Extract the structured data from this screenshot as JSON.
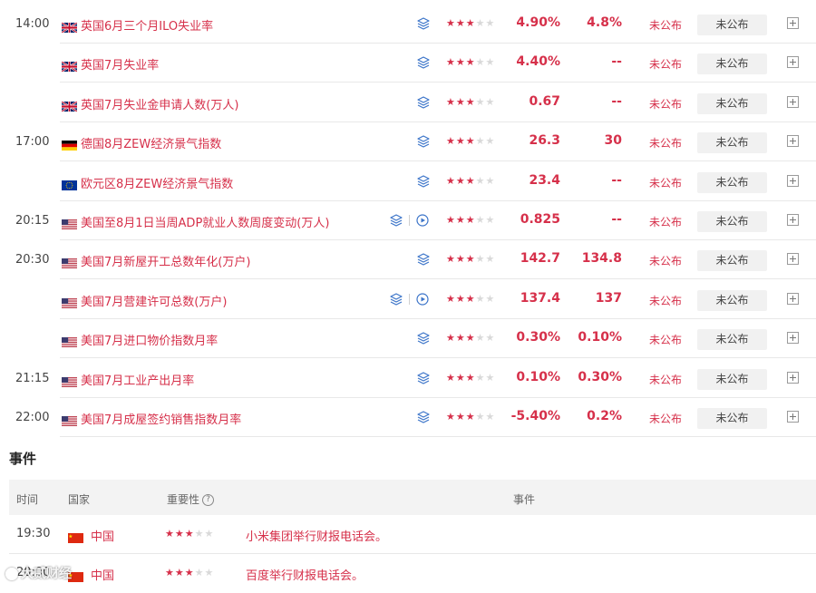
{
  "colors": {
    "accent": "#d6304a",
    "star_on": "#d6304a",
    "star_off": "#d9d9d9",
    "icon_blue": "#3b74c9"
  },
  "rows": [
    {
      "time": "14:00",
      "flag": "uk",
      "name": "英国6月三个月ILO失业率",
      "video": false,
      "stars": 3,
      "previous": "4.90%",
      "forecast": "4.8%",
      "status": "未公布",
      "button": "未公布"
    },
    {
      "time": "",
      "flag": "uk",
      "name": "英国7月失业率",
      "video": false,
      "stars": 3,
      "previous": "4.40%",
      "forecast": "--",
      "status": "未公布",
      "button": "未公布"
    },
    {
      "time": "",
      "flag": "uk",
      "name": "英国7月失业金申请人数(万人)",
      "video": false,
      "stars": 3,
      "previous": "0.67",
      "forecast": "--",
      "status": "未公布",
      "button": "未公布"
    },
    {
      "time": "17:00",
      "flag": "de",
      "name": "德国8月ZEW经济景气指数",
      "video": false,
      "stars": 3,
      "previous": "26.3",
      "forecast": "30",
      "status": "未公布",
      "button": "未公布"
    },
    {
      "time": "",
      "flag": "eu",
      "name": "欧元区8月ZEW经济景气指数",
      "video": false,
      "stars": 3,
      "previous": "23.4",
      "forecast": "--",
      "status": "未公布",
      "button": "未公布"
    },
    {
      "time": "20:15",
      "flag": "us",
      "name": "美国至8月1日当周ADP就业人数周度变动(万人)",
      "video": true,
      "stars": 3,
      "previous": "0.825",
      "forecast": "--",
      "status": "未公布",
      "button": "未公布"
    },
    {
      "time": "20:30",
      "flag": "us",
      "name": "美国7月新屋开工总数年化(万户)",
      "video": false,
      "stars": 3,
      "previous": "142.7",
      "forecast": "134.8",
      "status": "未公布",
      "button": "未公布"
    },
    {
      "time": "",
      "flag": "us",
      "name": "美国7月营建许可总数(万户)",
      "video": true,
      "stars": 3,
      "previous": "137.4",
      "forecast": "137",
      "status": "未公布",
      "button": "未公布"
    },
    {
      "time": "",
      "flag": "us",
      "name": "美国7月进口物价指数月率",
      "video": false,
      "stars": 3,
      "previous": "0.30%",
      "forecast": "0.10%",
      "status": "未公布",
      "button": "未公布"
    },
    {
      "time": "21:15",
      "flag": "us",
      "name": "美国7月工业产出月率",
      "video": false,
      "stars": 3,
      "previous": "0.10%",
      "forecast": "0.30%",
      "status": "未公布",
      "button": "未公布"
    },
    {
      "time": "22:00",
      "flag": "us",
      "name": "美国7月成屋签约销售指数月率",
      "video": false,
      "stars": 3,
      "previous": "-5.40%",
      "forecast": "0.2%",
      "status": "未公布",
      "button": "未公布"
    }
  ],
  "events": {
    "title": "事件",
    "headers": {
      "time": "时间",
      "country": "国家",
      "importance": "重要性",
      "help": "?",
      "event": "事件"
    },
    "rows": [
      {
        "time": "19:30",
        "flag": "cn",
        "country": "中国",
        "stars": 3,
        "text": "小米集团举行财报电话会。"
      },
      {
        "time": "20:00",
        "flag": "cn",
        "country": "中国",
        "stars": 3,
        "text": "百度举行财报电话会。"
      }
    ]
  },
  "watermark": "大贰财经"
}
